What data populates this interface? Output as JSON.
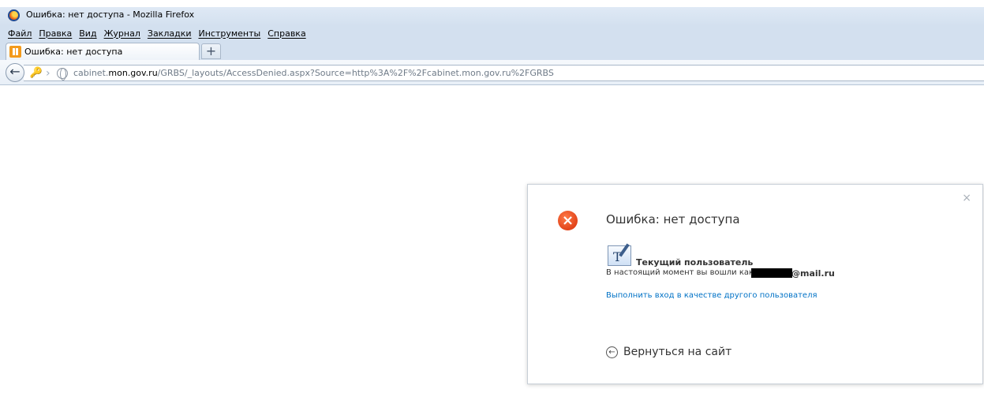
{
  "window": {
    "title": "Ошибка: нет доступа - Mozilla Firefox"
  },
  "menu": {
    "items": [
      "Файл",
      "Правка",
      "Вид",
      "Журнал",
      "Закладки",
      "Инструменты",
      "Справка"
    ]
  },
  "tab": {
    "label": "Ошибка: нет доступа",
    "new_tab_symbol": "+"
  },
  "url": {
    "prefix": "cabinet.",
    "host": "mon.gov.ru",
    "path": "/GRBS/_layouts/AccessDenied.aspx?Source=http%3A%2F%2Fcabinet.mon.gov.ru%2FGRBS"
  },
  "dialog": {
    "close_symbol": "×",
    "error_symbol": "×",
    "title": "Ошибка: нет доступа",
    "current_user_label": "Текущий пользователь",
    "logged_in_as": "В настоящий момент вы вошли как:",
    "email_suffix": "@mail.ru",
    "other_user_link": "Выполнить вход в качестве другого пользователя",
    "back_arrow": "←",
    "back_link": "Вернуться на сайт"
  },
  "icons": {
    "browser_logo": "firefox-logo-icon",
    "tab_favicon": "sharepoint-favicon-icon",
    "back": "back-arrow-icon",
    "identity": "key-icon",
    "site": "globe-icon",
    "error": "error-circle-icon",
    "user": "user-card-icon"
  }
}
